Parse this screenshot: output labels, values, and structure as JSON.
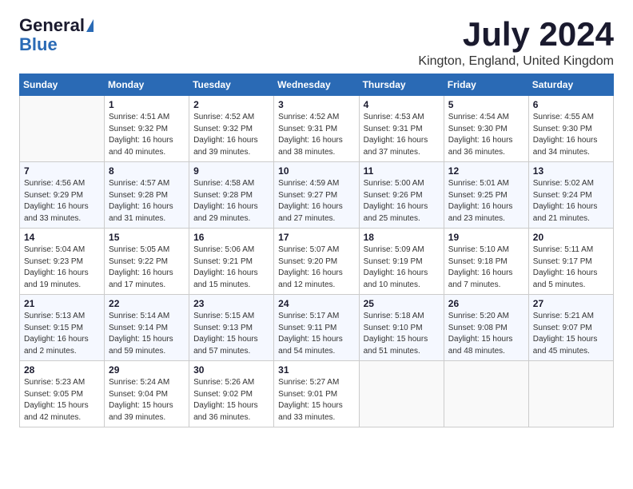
{
  "logo": {
    "general": "General",
    "blue": "Blue"
  },
  "title": "July 2024",
  "location": "Kington, England, United Kingdom",
  "weekdays": [
    "Sunday",
    "Monday",
    "Tuesday",
    "Wednesday",
    "Thursday",
    "Friday",
    "Saturday"
  ],
  "weeks": [
    [
      {
        "day": "",
        "info": ""
      },
      {
        "day": "1",
        "info": "Sunrise: 4:51 AM\nSunset: 9:32 PM\nDaylight: 16 hours\nand 40 minutes."
      },
      {
        "day": "2",
        "info": "Sunrise: 4:52 AM\nSunset: 9:32 PM\nDaylight: 16 hours\nand 39 minutes."
      },
      {
        "day": "3",
        "info": "Sunrise: 4:52 AM\nSunset: 9:31 PM\nDaylight: 16 hours\nand 38 minutes."
      },
      {
        "day": "4",
        "info": "Sunrise: 4:53 AM\nSunset: 9:31 PM\nDaylight: 16 hours\nand 37 minutes."
      },
      {
        "day": "5",
        "info": "Sunrise: 4:54 AM\nSunset: 9:30 PM\nDaylight: 16 hours\nand 36 minutes."
      },
      {
        "day": "6",
        "info": "Sunrise: 4:55 AM\nSunset: 9:30 PM\nDaylight: 16 hours\nand 34 minutes."
      }
    ],
    [
      {
        "day": "7",
        "info": "Sunrise: 4:56 AM\nSunset: 9:29 PM\nDaylight: 16 hours\nand 33 minutes."
      },
      {
        "day": "8",
        "info": "Sunrise: 4:57 AM\nSunset: 9:28 PM\nDaylight: 16 hours\nand 31 minutes."
      },
      {
        "day": "9",
        "info": "Sunrise: 4:58 AM\nSunset: 9:28 PM\nDaylight: 16 hours\nand 29 minutes."
      },
      {
        "day": "10",
        "info": "Sunrise: 4:59 AM\nSunset: 9:27 PM\nDaylight: 16 hours\nand 27 minutes."
      },
      {
        "day": "11",
        "info": "Sunrise: 5:00 AM\nSunset: 9:26 PM\nDaylight: 16 hours\nand 25 minutes."
      },
      {
        "day": "12",
        "info": "Sunrise: 5:01 AM\nSunset: 9:25 PM\nDaylight: 16 hours\nand 23 minutes."
      },
      {
        "day": "13",
        "info": "Sunrise: 5:02 AM\nSunset: 9:24 PM\nDaylight: 16 hours\nand 21 minutes."
      }
    ],
    [
      {
        "day": "14",
        "info": "Sunrise: 5:04 AM\nSunset: 9:23 PM\nDaylight: 16 hours\nand 19 minutes."
      },
      {
        "day": "15",
        "info": "Sunrise: 5:05 AM\nSunset: 9:22 PM\nDaylight: 16 hours\nand 17 minutes."
      },
      {
        "day": "16",
        "info": "Sunrise: 5:06 AM\nSunset: 9:21 PM\nDaylight: 16 hours\nand 15 minutes."
      },
      {
        "day": "17",
        "info": "Sunrise: 5:07 AM\nSunset: 9:20 PM\nDaylight: 16 hours\nand 12 minutes."
      },
      {
        "day": "18",
        "info": "Sunrise: 5:09 AM\nSunset: 9:19 PM\nDaylight: 16 hours\nand 10 minutes."
      },
      {
        "day": "19",
        "info": "Sunrise: 5:10 AM\nSunset: 9:18 PM\nDaylight: 16 hours\nand 7 minutes."
      },
      {
        "day": "20",
        "info": "Sunrise: 5:11 AM\nSunset: 9:17 PM\nDaylight: 16 hours\nand 5 minutes."
      }
    ],
    [
      {
        "day": "21",
        "info": "Sunrise: 5:13 AM\nSunset: 9:15 PM\nDaylight: 16 hours\nand 2 minutes."
      },
      {
        "day": "22",
        "info": "Sunrise: 5:14 AM\nSunset: 9:14 PM\nDaylight: 15 hours\nand 59 minutes."
      },
      {
        "day": "23",
        "info": "Sunrise: 5:15 AM\nSunset: 9:13 PM\nDaylight: 15 hours\nand 57 minutes."
      },
      {
        "day": "24",
        "info": "Sunrise: 5:17 AM\nSunset: 9:11 PM\nDaylight: 15 hours\nand 54 minutes."
      },
      {
        "day": "25",
        "info": "Sunrise: 5:18 AM\nSunset: 9:10 PM\nDaylight: 15 hours\nand 51 minutes."
      },
      {
        "day": "26",
        "info": "Sunrise: 5:20 AM\nSunset: 9:08 PM\nDaylight: 15 hours\nand 48 minutes."
      },
      {
        "day": "27",
        "info": "Sunrise: 5:21 AM\nSunset: 9:07 PM\nDaylight: 15 hours\nand 45 minutes."
      }
    ],
    [
      {
        "day": "28",
        "info": "Sunrise: 5:23 AM\nSunset: 9:05 PM\nDaylight: 15 hours\nand 42 minutes."
      },
      {
        "day": "29",
        "info": "Sunrise: 5:24 AM\nSunset: 9:04 PM\nDaylight: 15 hours\nand 39 minutes."
      },
      {
        "day": "30",
        "info": "Sunrise: 5:26 AM\nSunset: 9:02 PM\nDaylight: 15 hours\nand 36 minutes."
      },
      {
        "day": "31",
        "info": "Sunrise: 5:27 AM\nSunset: 9:01 PM\nDaylight: 15 hours\nand 33 minutes."
      },
      {
        "day": "",
        "info": ""
      },
      {
        "day": "",
        "info": ""
      },
      {
        "day": "",
        "info": ""
      }
    ]
  ]
}
